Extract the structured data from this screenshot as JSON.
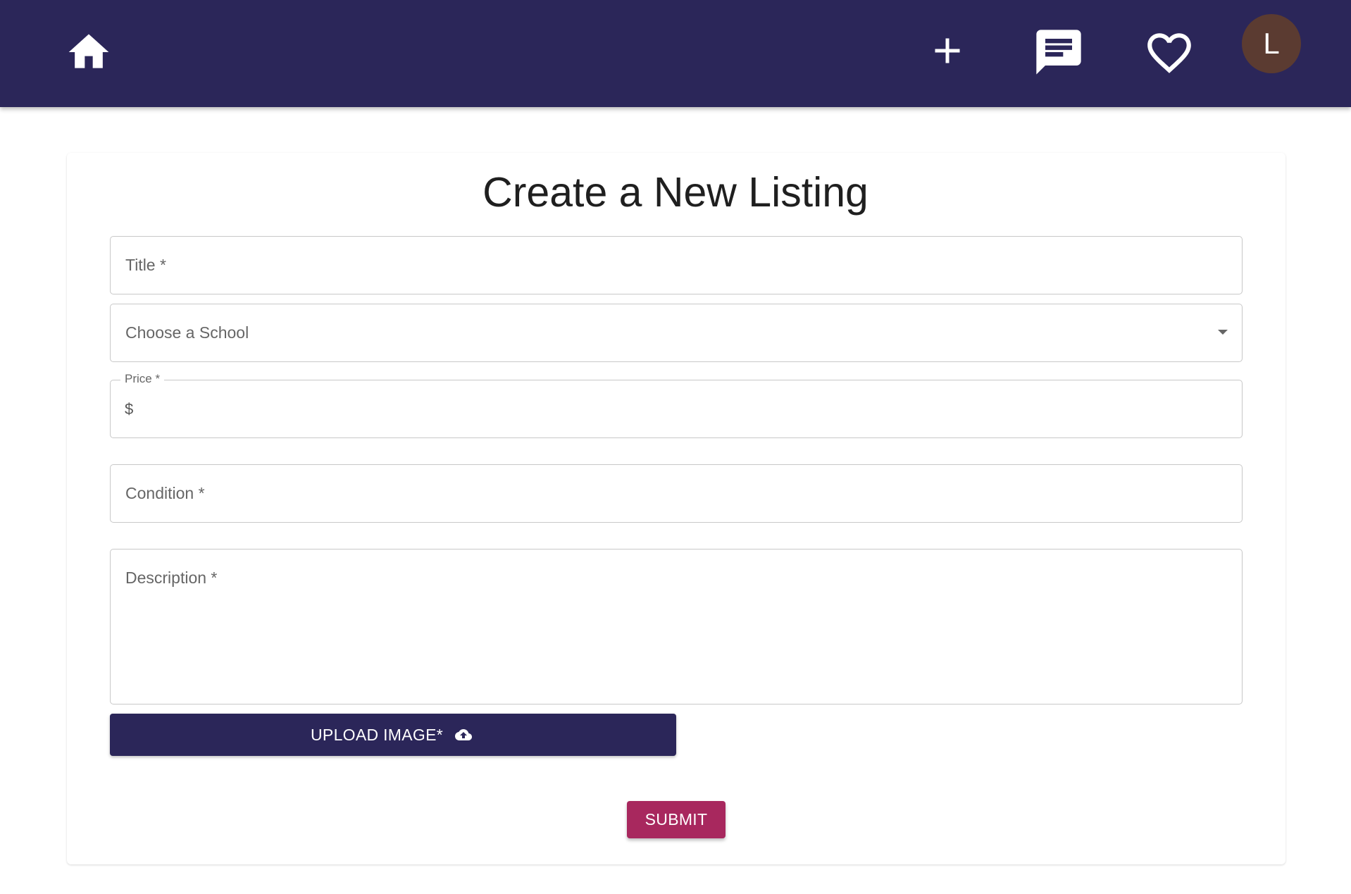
{
  "header": {
    "background_color": "#2b2659",
    "icons": {
      "home": "home-icon",
      "add": "add-icon",
      "messages": "chat-icon",
      "favorites": "heart-icon"
    },
    "avatar": {
      "initial": "L",
      "color": "#5b3b31"
    }
  },
  "form": {
    "title": "Create a New Listing",
    "fields": {
      "title_label": "Title *",
      "school_placeholder": "Choose a School",
      "price_label": "Price *",
      "price_adornment": "$",
      "condition_label": "Condition *",
      "description_label": "Description *"
    },
    "upload_button_label": "UPLOAD IMAGE*",
    "upload_icon": "cloud-upload-icon",
    "submit_button_label": "SUBMIT",
    "submit_color": "#a8285e"
  }
}
